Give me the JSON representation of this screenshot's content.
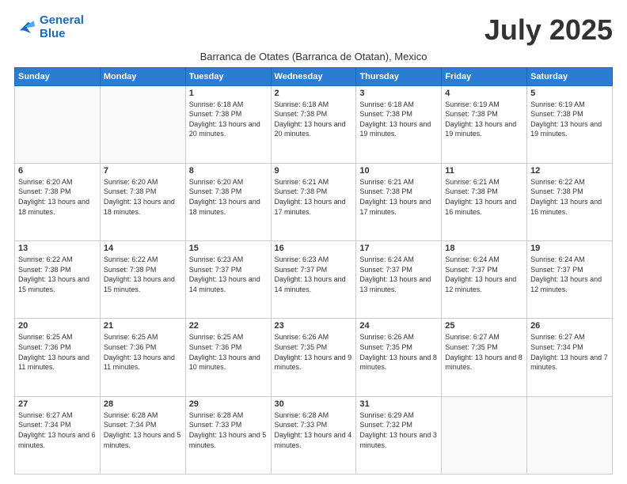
{
  "header": {
    "logo_line1": "General",
    "logo_line2": "Blue",
    "month_title": "July 2025",
    "subtitle": "Barranca de Otates (Barranca de Otatan), Mexico"
  },
  "days_of_week": [
    "Sunday",
    "Monday",
    "Tuesday",
    "Wednesday",
    "Thursday",
    "Friday",
    "Saturday"
  ],
  "weeks": [
    [
      {
        "day": "",
        "info": ""
      },
      {
        "day": "",
        "info": ""
      },
      {
        "day": "1",
        "info": "Sunrise: 6:18 AM\nSunset: 7:38 PM\nDaylight: 13 hours and 20 minutes."
      },
      {
        "day": "2",
        "info": "Sunrise: 6:18 AM\nSunset: 7:38 PM\nDaylight: 13 hours and 20 minutes."
      },
      {
        "day": "3",
        "info": "Sunrise: 6:18 AM\nSunset: 7:38 PM\nDaylight: 13 hours and 19 minutes."
      },
      {
        "day": "4",
        "info": "Sunrise: 6:19 AM\nSunset: 7:38 PM\nDaylight: 13 hours and 19 minutes."
      },
      {
        "day": "5",
        "info": "Sunrise: 6:19 AM\nSunset: 7:38 PM\nDaylight: 13 hours and 19 minutes."
      }
    ],
    [
      {
        "day": "6",
        "info": "Sunrise: 6:20 AM\nSunset: 7:38 PM\nDaylight: 13 hours and 18 minutes."
      },
      {
        "day": "7",
        "info": "Sunrise: 6:20 AM\nSunset: 7:38 PM\nDaylight: 13 hours and 18 minutes."
      },
      {
        "day": "8",
        "info": "Sunrise: 6:20 AM\nSunset: 7:38 PM\nDaylight: 13 hours and 18 minutes."
      },
      {
        "day": "9",
        "info": "Sunrise: 6:21 AM\nSunset: 7:38 PM\nDaylight: 13 hours and 17 minutes."
      },
      {
        "day": "10",
        "info": "Sunrise: 6:21 AM\nSunset: 7:38 PM\nDaylight: 13 hours and 17 minutes."
      },
      {
        "day": "11",
        "info": "Sunrise: 6:21 AM\nSunset: 7:38 PM\nDaylight: 13 hours and 16 minutes."
      },
      {
        "day": "12",
        "info": "Sunrise: 6:22 AM\nSunset: 7:38 PM\nDaylight: 13 hours and 16 minutes."
      }
    ],
    [
      {
        "day": "13",
        "info": "Sunrise: 6:22 AM\nSunset: 7:38 PM\nDaylight: 13 hours and 15 minutes."
      },
      {
        "day": "14",
        "info": "Sunrise: 6:22 AM\nSunset: 7:38 PM\nDaylight: 13 hours and 15 minutes."
      },
      {
        "day": "15",
        "info": "Sunrise: 6:23 AM\nSunset: 7:37 PM\nDaylight: 13 hours and 14 minutes."
      },
      {
        "day": "16",
        "info": "Sunrise: 6:23 AM\nSunset: 7:37 PM\nDaylight: 13 hours and 14 minutes."
      },
      {
        "day": "17",
        "info": "Sunrise: 6:24 AM\nSunset: 7:37 PM\nDaylight: 13 hours and 13 minutes."
      },
      {
        "day": "18",
        "info": "Sunrise: 6:24 AM\nSunset: 7:37 PM\nDaylight: 13 hours and 12 minutes."
      },
      {
        "day": "19",
        "info": "Sunrise: 6:24 AM\nSunset: 7:37 PM\nDaylight: 13 hours and 12 minutes."
      }
    ],
    [
      {
        "day": "20",
        "info": "Sunrise: 6:25 AM\nSunset: 7:36 PM\nDaylight: 13 hours and 11 minutes."
      },
      {
        "day": "21",
        "info": "Sunrise: 6:25 AM\nSunset: 7:36 PM\nDaylight: 13 hours and 11 minutes."
      },
      {
        "day": "22",
        "info": "Sunrise: 6:25 AM\nSunset: 7:36 PM\nDaylight: 13 hours and 10 minutes."
      },
      {
        "day": "23",
        "info": "Sunrise: 6:26 AM\nSunset: 7:35 PM\nDaylight: 13 hours and 9 minutes."
      },
      {
        "day": "24",
        "info": "Sunrise: 6:26 AM\nSunset: 7:35 PM\nDaylight: 13 hours and 8 minutes."
      },
      {
        "day": "25",
        "info": "Sunrise: 6:27 AM\nSunset: 7:35 PM\nDaylight: 13 hours and 8 minutes."
      },
      {
        "day": "26",
        "info": "Sunrise: 6:27 AM\nSunset: 7:34 PM\nDaylight: 13 hours and 7 minutes."
      }
    ],
    [
      {
        "day": "27",
        "info": "Sunrise: 6:27 AM\nSunset: 7:34 PM\nDaylight: 13 hours and 6 minutes."
      },
      {
        "day": "28",
        "info": "Sunrise: 6:28 AM\nSunset: 7:34 PM\nDaylight: 13 hours and 5 minutes."
      },
      {
        "day": "29",
        "info": "Sunrise: 6:28 AM\nSunset: 7:33 PM\nDaylight: 13 hours and 5 minutes."
      },
      {
        "day": "30",
        "info": "Sunrise: 6:28 AM\nSunset: 7:33 PM\nDaylight: 13 hours and 4 minutes."
      },
      {
        "day": "31",
        "info": "Sunrise: 6:29 AM\nSunset: 7:32 PM\nDaylight: 13 hours and 3 minutes."
      },
      {
        "day": "",
        "info": ""
      },
      {
        "day": "",
        "info": ""
      }
    ]
  ]
}
